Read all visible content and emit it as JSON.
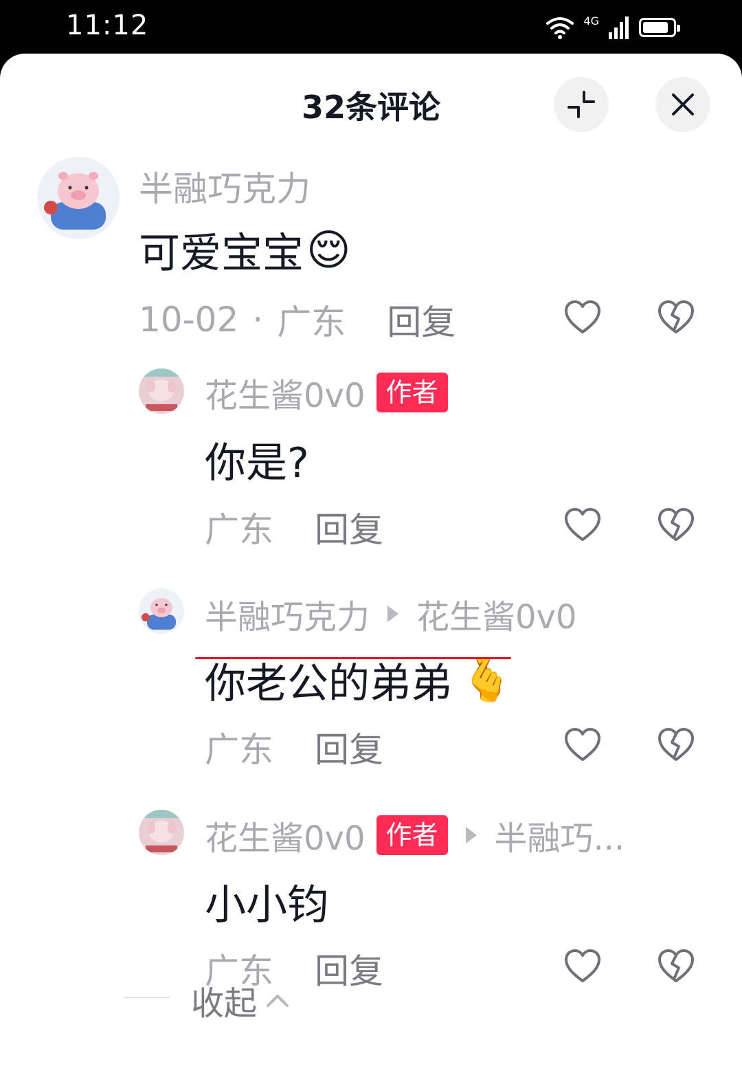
{
  "status_bar": {
    "time": "11:12",
    "network": "4G",
    "battery_level": 0.9
  },
  "header": {
    "title": "32条评论"
  },
  "comments": [
    {
      "user": "半融巧克力",
      "text": "可爱宝宝",
      "emoji": "😌",
      "date": "10-02",
      "separator": "·",
      "location": "广东",
      "reply_label": "回复"
    }
  ],
  "replies": [
    {
      "user": "花生酱0v0",
      "badge": "作者",
      "text": "你是?",
      "location": "广东",
      "reply_label": "回复"
    },
    {
      "user": "半融巧克力",
      "reply_to": "花生酱0v0",
      "text": "你老公的弟弟",
      "emoji": "🫰",
      "location": "广东",
      "reply_label": "回复"
    },
    {
      "user": "花生酱0v0",
      "badge": "作者",
      "reply_to": "半融巧...",
      "text": "小小钧",
      "location": "广东",
      "reply_label": "回复"
    }
  ],
  "footer": {
    "collapse_label": "收起"
  },
  "icons": {
    "like": "heart-outline-icon",
    "dislike": "broken-heart-icon",
    "shrink": "shrink-icon",
    "close": "close-icon",
    "collapse": "chevron-up-icon"
  },
  "colors": {
    "badge": "#fe2c55",
    "underline": "#e0151c",
    "text": "#161823",
    "muted": "#a9aab0"
  }
}
